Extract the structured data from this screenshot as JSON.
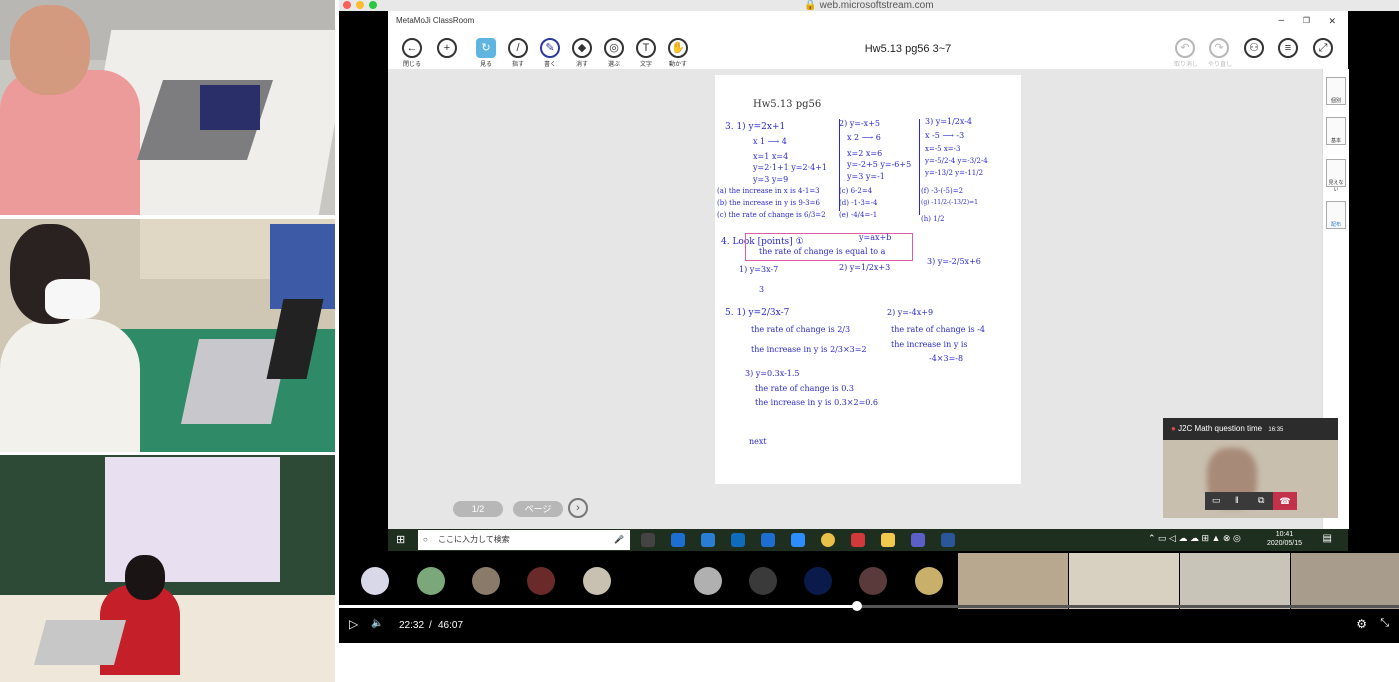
{
  "browser": {
    "url": "web.microsoftstream.com"
  },
  "app": {
    "window_title": "MetaMoJi ClassRoom",
    "doc_title": "Hw5.13 pg56 3~7",
    "tools": [
      {
        "label": "閉じる",
        "icon": "back-arrow-icon"
      },
      {
        "label": "",
        "icon": "plus-icon"
      },
      {
        "label": "見る",
        "icon": "view-icon"
      },
      {
        "label": "指す",
        "icon": "pointer-icon"
      },
      {
        "label": "書く",
        "icon": "pen-icon"
      },
      {
        "label": "消す",
        "icon": "eraser-icon"
      },
      {
        "label": "選ぶ",
        "icon": "lasso-icon"
      },
      {
        "label": "文字",
        "icon": "text-icon"
      },
      {
        "label": "動かす",
        "icon": "hand-icon"
      }
    ],
    "right_tools": [
      {
        "label": "取り消し",
        "icon": "undo-icon"
      },
      {
        "label": "やり直し",
        "icon": "redo-icon"
      },
      {
        "label": "",
        "icon": "users-icon"
      },
      {
        "label": "",
        "icon": "menu-icon"
      },
      {
        "label": "",
        "icon": "fullscreen-icon"
      }
    ],
    "side_tools": [
      {
        "label": "個別",
        "icon": "individual-icon"
      },
      {
        "label": "基本",
        "icon": "layers-icon"
      },
      {
        "label": "見えない",
        "icon": "hide-icon"
      },
      {
        "label": "配布",
        "icon": "distribute-icon"
      }
    ],
    "page_indicator": "1/2",
    "page_button": "ページ"
  },
  "worksheet": {
    "heading": "Hw5.13  pg56",
    "lines": [
      "3.  1)  y=2x+1",
      "x  1 ⟶ 4",
      "x=1      x=4",
      "y=2·1+1   y=2·4+1",
      "y=3       y=9",
      "(a) the increase in x is 4-1=3",
      "(b) the increase in y is 9-3=6",
      "(c) the rate of change is 6/3=2",
      "4.  Look [points] ①",
      "the rate of change is equal to a",
      "y=ax+b",
      "1)  y=3x-7",
      "3",
      "2)  y=1/2x+3",
      "3)  y=-2/5x+6",
      "5.  1)  y=2/3x-7",
      "the rate of change is 2/3",
      "the increase in y is 2/3×3=2",
      "2)  y=-4x+9",
      "the rate of change is -4",
      "the increase in y is",
      "-4×3=-8",
      "3)  y=0.3x-1.5",
      "the rate of change is 0.3",
      "the increase in y is 0.3×2=0.6",
      "next",
      "2)  y=-x+5",
      "x  2 ⟶ 6",
      "x=2     x=6",
      "y=-2+5   y=-6+5",
      "y=3     y=-1",
      "(c) 6-2=4",
      "(d) -1-3=-4",
      "(e) -4/4=-1",
      "3)  y=1/2x-4",
      "x  -5 ⟶ -3",
      "x=-5    x=-3",
      "y=-5/2-4  y=-3/2-4",
      "y=-13/2  y=-11/2",
      "(f) -3-(-5)=2",
      "(g) -11/2-(-13/2)=1",
      "(h) 1/2"
    ]
  },
  "taskbar": {
    "search_placeholder": "ここに入力して検索",
    "time": "10:41",
    "date": "2020/05/15"
  },
  "teams": {
    "title": "J2C Math question time",
    "elapsed": "16:35"
  },
  "player": {
    "current_time": "22:32",
    "separator": "/",
    "duration": "46:07",
    "progress": 0.489
  }
}
